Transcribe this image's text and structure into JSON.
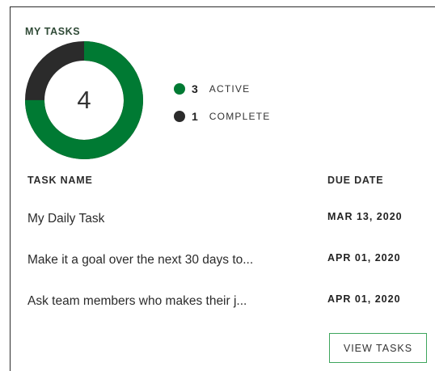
{
  "widget": {
    "title": "MY TASKS",
    "total": "4",
    "legend": [
      {
        "count": "3",
        "label": "ACTIVE",
        "color": "#007a33"
      },
      {
        "count": "1",
        "label": "COMPLETE",
        "color": "#2b2b2b"
      }
    ],
    "donut": {
      "active": 3,
      "complete": 1
    }
  },
  "table": {
    "headers": {
      "name": "TASK NAME",
      "due": "DUE DATE"
    },
    "rows": [
      {
        "name": "My Daily Task",
        "due": "MAR 13, 2020"
      },
      {
        "name": "Make it a goal over the next 30 days to...",
        "due": "APR 01, 2020"
      },
      {
        "name": "Ask team members who makes their j...",
        "due": "APR 01, 2020"
      }
    ]
  },
  "actions": {
    "view_tasks": "VIEW TASKS"
  },
  "colors": {
    "active": "#007a33",
    "complete": "#2b2b2b",
    "button_border": "#3ea55d"
  }
}
